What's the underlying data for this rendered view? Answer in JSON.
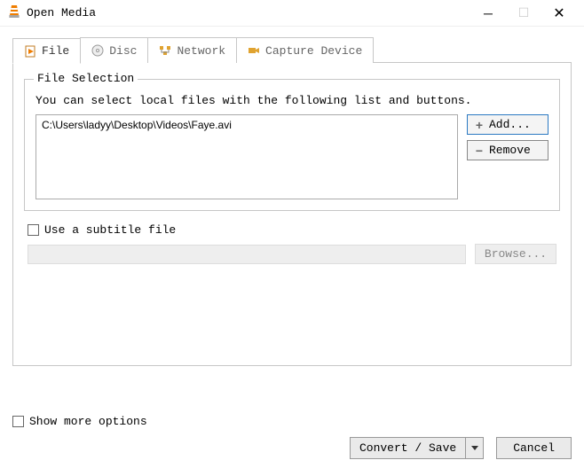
{
  "window": {
    "title": "Open Media"
  },
  "tabs": {
    "file": "File",
    "disc": "Disc",
    "network": "Network",
    "capture": "Capture Device"
  },
  "fileSection": {
    "legend": "File Selection",
    "hint": "You can select local files with the following list and buttons.",
    "files": [
      "C:\\Users\\ladyy\\Desktop\\Videos\\Faye.avi"
    ],
    "add": "Add...",
    "remove": "Remove"
  },
  "subtitle": {
    "label": "Use a subtitle file",
    "browse": "Browse..."
  },
  "footer": {
    "more": "Show more options",
    "convert": "Convert / Save",
    "cancel": "Cancel"
  }
}
